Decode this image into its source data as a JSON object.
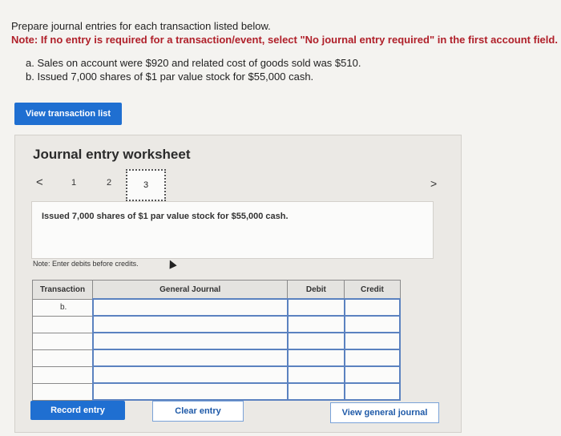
{
  "instructions": {
    "line1": "Prepare journal entries for each transaction listed below.",
    "note": "Note: If no entry is required for a transaction/event, select \"No journal entry required\" in the first account field."
  },
  "transactions": [
    "a. Sales on account were $920 and related cost of goods sold was $510.",
    "b. Issued 7,000 shares of $1 par value stock for $55,000 cash."
  ],
  "view_transaction_button": "View transaction list",
  "worksheet": {
    "title": "Journal entry worksheet",
    "nav": {
      "prev": "<",
      "next": ">",
      "pages": [
        "1",
        "2",
        "3"
      ]
    },
    "description": "Issued 7,000 shares of $1 par value stock for $55,000 cash.",
    "debits_note": "Note: Enter debits before credits.",
    "table": {
      "headers": [
        "Transaction",
        "General Journal",
        "Debit",
        "Credit"
      ],
      "rows": [
        [
          "b.",
          "",
          "",
          ""
        ],
        [
          "",
          "",
          "",
          ""
        ],
        [
          "",
          "",
          "",
          ""
        ],
        [
          "",
          "",
          "",
          ""
        ],
        [
          "",
          "",
          "",
          ""
        ],
        [
          "",
          "",
          "",
          ""
        ]
      ]
    },
    "buttons": {
      "record": "Record entry",
      "clear": "Clear entry",
      "view_journal": "View general journal"
    }
  }
}
